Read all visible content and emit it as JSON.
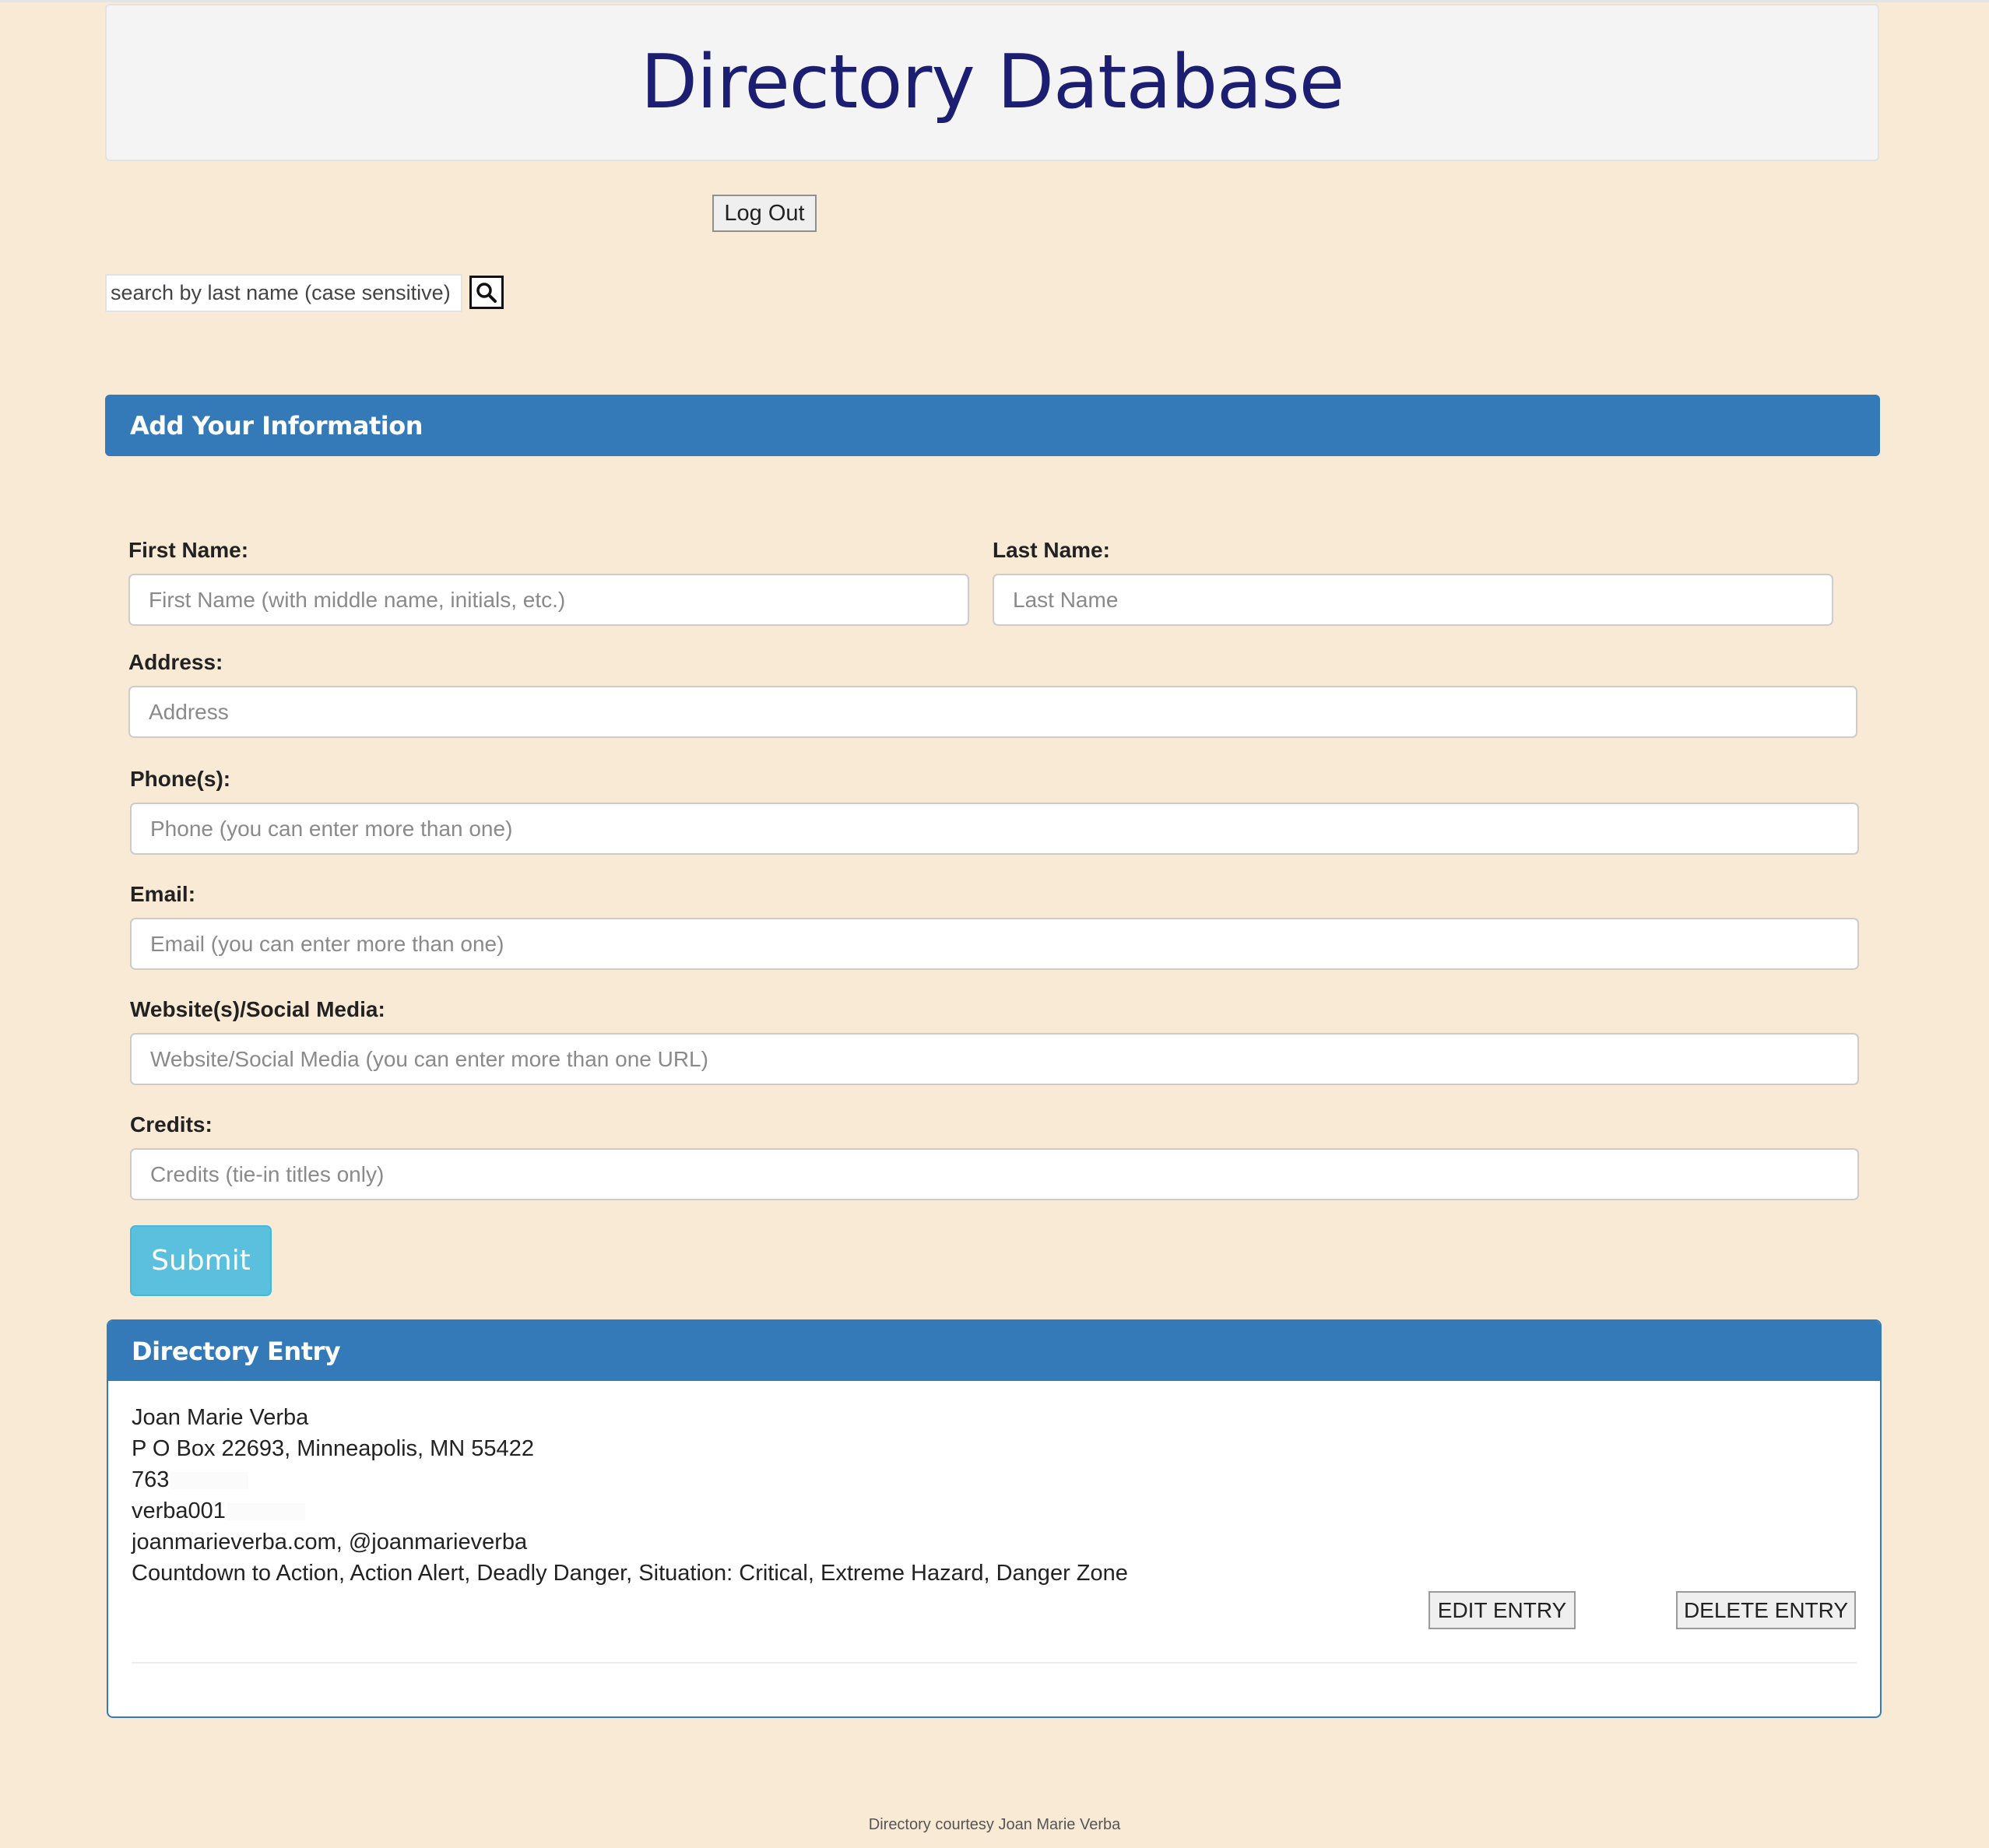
{
  "header": {
    "title": "Directory Database"
  },
  "actions": {
    "logout_label": "Log Out"
  },
  "search": {
    "placeholder": "search by last name (case sensitive)",
    "button_icon": "search-icon"
  },
  "add_form": {
    "heading": "Add Your Information",
    "first_name": {
      "label": "First Name:",
      "placeholder": "First Name (with middle name, initials, etc.)",
      "value": ""
    },
    "last_name": {
      "label": "Last Name:",
      "placeholder": "Last Name",
      "value": ""
    },
    "address": {
      "label": "Address:",
      "placeholder": "Address",
      "value": ""
    },
    "phone": {
      "label": "Phone(s):",
      "placeholder": "Phone (you can enter more than one)",
      "value": ""
    },
    "email": {
      "label": "Email:",
      "placeholder": "Email (you can enter more than one)",
      "value": ""
    },
    "website": {
      "label": "Website(s)/Social Media:",
      "placeholder": "Website/Social Media (you can enter more than one URL)",
      "value": ""
    },
    "credits": {
      "label": "Credits:",
      "placeholder": "Credits (tie-in titles only)",
      "value": ""
    },
    "submit_label": "Submit"
  },
  "entry": {
    "heading": "Directory Entry",
    "name": "Joan Marie Verba",
    "address": "P O Box 22693, Minneapolis, MN 55422",
    "phone": "763",
    "email": "verba001",
    "websites": "joanmarieverba.com, @joanmarieverba",
    "credits": "Countdown to Action, Action Alert, Deadly Danger, Situation: Critical, Extreme Hazard, Danger Zone",
    "edit_label": "EDIT ENTRY",
    "delete_label": "DELETE ENTRY"
  },
  "footer": {
    "text": "Directory courtesy Joan Marie Verba"
  },
  "colors": {
    "page_background": "#f9ead6",
    "title_color": "#1c1e72",
    "panel_heading": "#357ab8",
    "submit_button": "#5bc0de"
  }
}
